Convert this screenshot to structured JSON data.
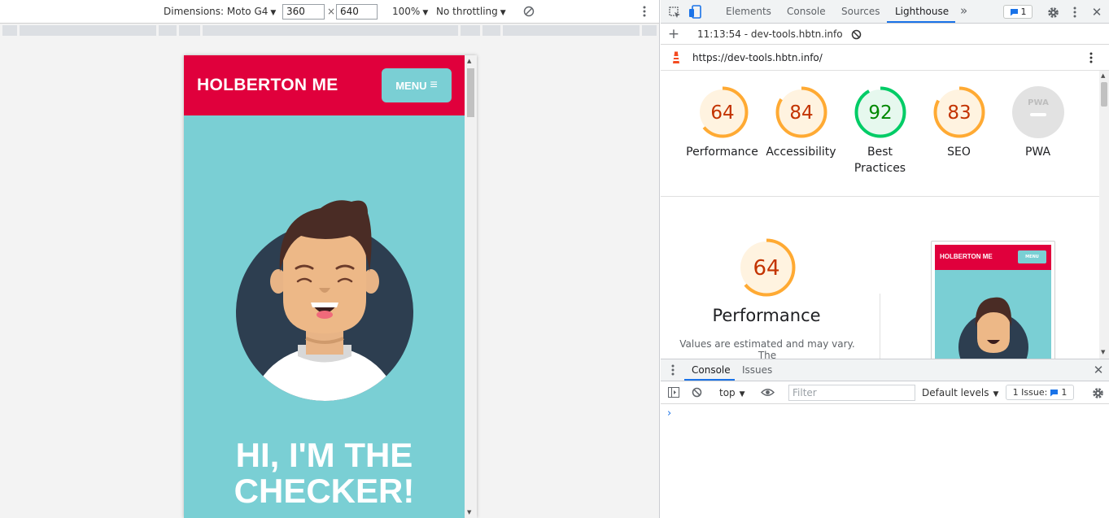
{
  "device_toolbar": {
    "dimensions_label": "Dimensions: Moto G4",
    "width_value": "360",
    "times": "×",
    "height_value": "640",
    "zoom": "100%",
    "throttling": "No throttling",
    "rotate_icon": "rotate-icon",
    "more_icon": "kebab-icon"
  },
  "preview": {
    "brand": "HOLBERTON ME",
    "menu_label": "MENU",
    "menu_glyph": "≡",
    "hero_line1": "HI, I'M THE",
    "hero_line2": "CHECKER!",
    "colors": {
      "header": "#e0003c",
      "background": "#7acfd4",
      "avatar_circle": "#2d3e50"
    }
  },
  "devtools": {
    "tabs": [
      "Elements",
      "Console",
      "Sources",
      "Lighthouse"
    ],
    "active_tab": "Lighthouse",
    "more_tabs": "»",
    "issues_count": "1",
    "lighthouse_report_label": "11:13:54 - dev-tools.hbtn.info",
    "url": "https://dev-tools.hbtn.info/",
    "scores": [
      {
        "name": "Performance",
        "score": 64,
        "color": "#fa3",
        "text_color": "#c33300"
      },
      {
        "name": "Accessibility",
        "score": 84,
        "color": "#fa3",
        "text_color": "#c33300"
      },
      {
        "name": "Best Practices",
        "score": 92,
        "color": "#0c6",
        "text_color": "#080"
      },
      {
        "name": "SEO",
        "score": 83,
        "color": "#fa3",
        "text_color": "#c33300"
      },
      {
        "name": "PWA",
        "score": null,
        "color": "#e0e0e0",
        "text_color": "#9aa0a6"
      }
    ],
    "pwa_badge": "PWA",
    "performance_detail": {
      "score": "64",
      "title": "Performance",
      "note": "Values are estimated and may vary. The"
    },
    "thumbnail": {
      "brand": "HOLBERTON ME",
      "menu_label": "MENU"
    }
  },
  "drawer": {
    "tabs": [
      "Console",
      "Issues"
    ],
    "active_tab": "Console",
    "context": "top",
    "filter_placeholder": "Filter",
    "levels": "Default levels",
    "issue_label": "1 Issue:",
    "issue_count": "1",
    "prompt": "›"
  }
}
